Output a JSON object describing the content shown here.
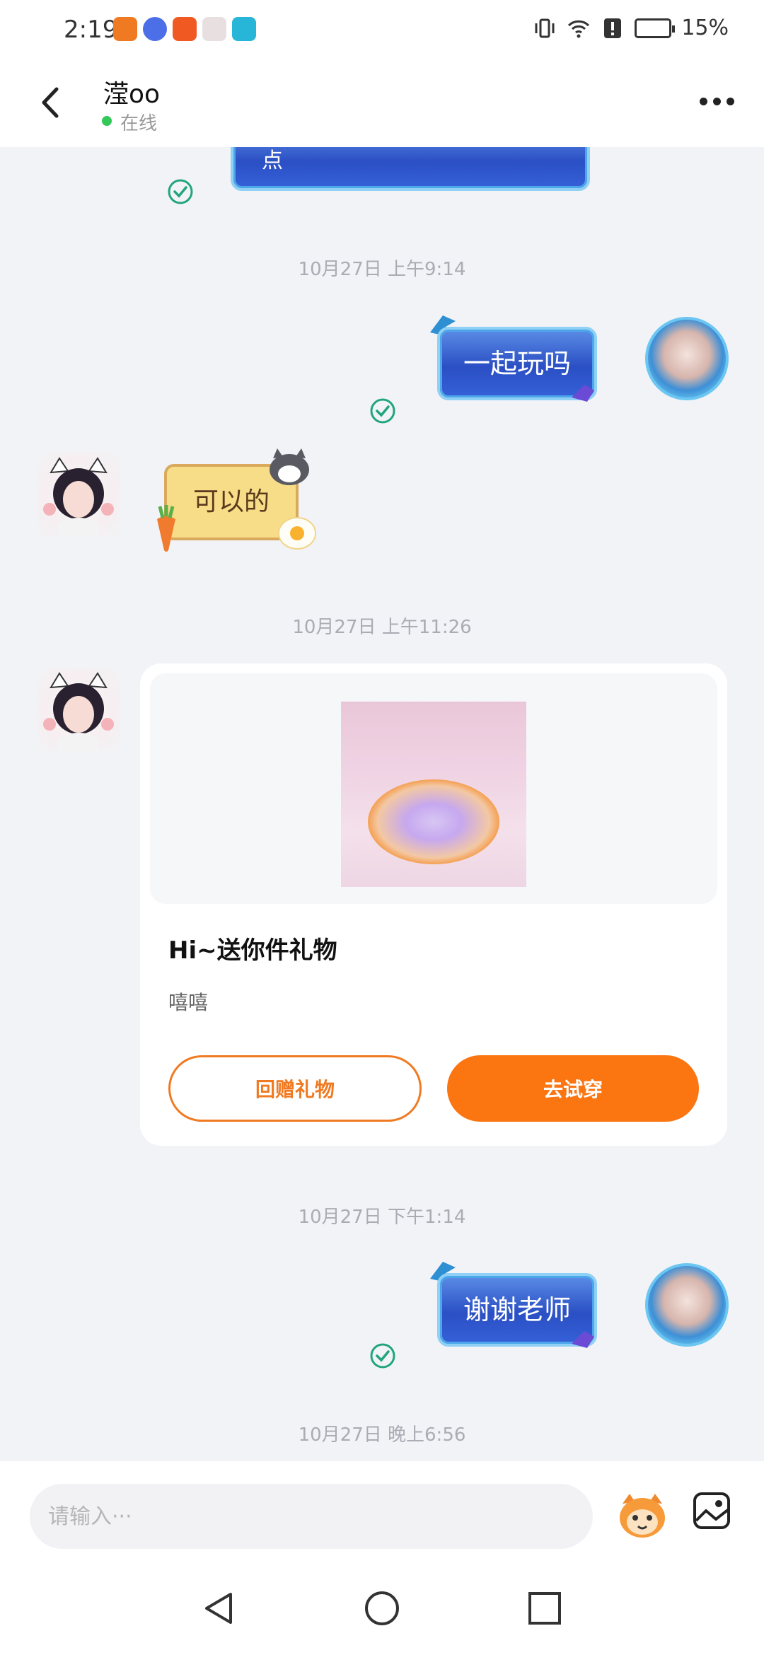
{
  "status_bar": {
    "time": "2:19",
    "battery": "15%"
  },
  "header": {
    "contact_name": "滢oo",
    "status": "在线"
  },
  "messages": {
    "time_1": "10月27日 上午9:14",
    "msg_1": "一起玩吗",
    "msg_2": "可以的",
    "time_2": "10月27日 上午11:26",
    "gift": {
      "title": "Hi~送你件礼物",
      "subtitle": "嘻嘻",
      "return_button": "回赠礼物",
      "try_button": "去试穿"
    },
    "time_3": "10月27日 下午1:14",
    "msg_3": "谢谢老师",
    "time_4": "10月27日 晚上6:56",
    "partial_top": "点"
  },
  "input": {
    "placeholder": "请输入···"
  },
  "colors": {
    "accent": "#fb7511",
    "online": "#34c759",
    "check": "#22a57a"
  }
}
